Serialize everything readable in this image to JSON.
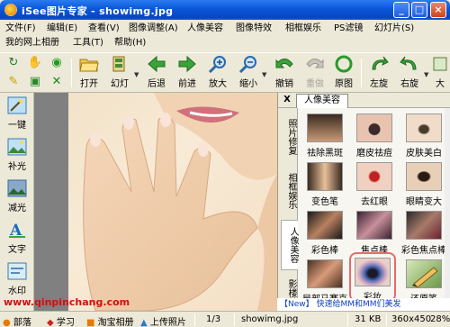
{
  "window": {
    "title": "iSee图片专家 - showimg.jpg"
  },
  "menu": [
    "文件(F)",
    "编辑(E)",
    "查看(V)",
    "图像调整(A)",
    "人像美容",
    "图像特效",
    "相框娱乐",
    "PS滤镜",
    "幻灯片(S)",
    "我的网上相册",
    "工具(T)",
    "帮助(H)"
  ],
  "toolbar": {
    "open": "打开",
    "slideshow": "幻灯",
    "back": "后退",
    "forward": "前进",
    "zoom_in": "放大",
    "zoom_out": "缩小",
    "undo": "撤销",
    "redo": "重做",
    "original": "原图",
    "rotate_left": "左旋",
    "rotate_right": "右旋",
    "more": "大"
  },
  "left_panel": [
    "一键",
    "补光",
    "减光",
    "文字",
    "水印"
  ],
  "right_panel": {
    "close": "X",
    "active_tab": "人像美容",
    "vertical_tabs": [
      "照片修复",
      "相框娱乐",
      "人像美容",
      "影楼效"
    ],
    "tools": [
      "祛除黑斑",
      "磨皮祛痘",
      "皮肤美白",
      "变色笔",
      "去红眼",
      "眼睛变大",
      "彩色棒",
      "焦点棒",
      "彩色焦点棒",
      "局部马赛克",
      "彩妆",
      "还原笔"
    ],
    "selected_tool": "彩妆"
  },
  "web": {
    "url": "www.qinpinchang.com"
  },
  "promo": "【New】 快速给MM和MM们美发",
  "status": {
    "items": [
      "部落",
      "学习",
      "淘宝相册",
      "上传照片"
    ],
    "page": "1/3",
    "filename": "showimg.jpg",
    "size": "31 KB",
    "dimensions": "360x450",
    "zoom": "28%"
  },
  "colors": {
    "title_bar": "#0a56d8",
    "selection_border": "#e76b6b",
    "url": "#d01010"
  }
}
